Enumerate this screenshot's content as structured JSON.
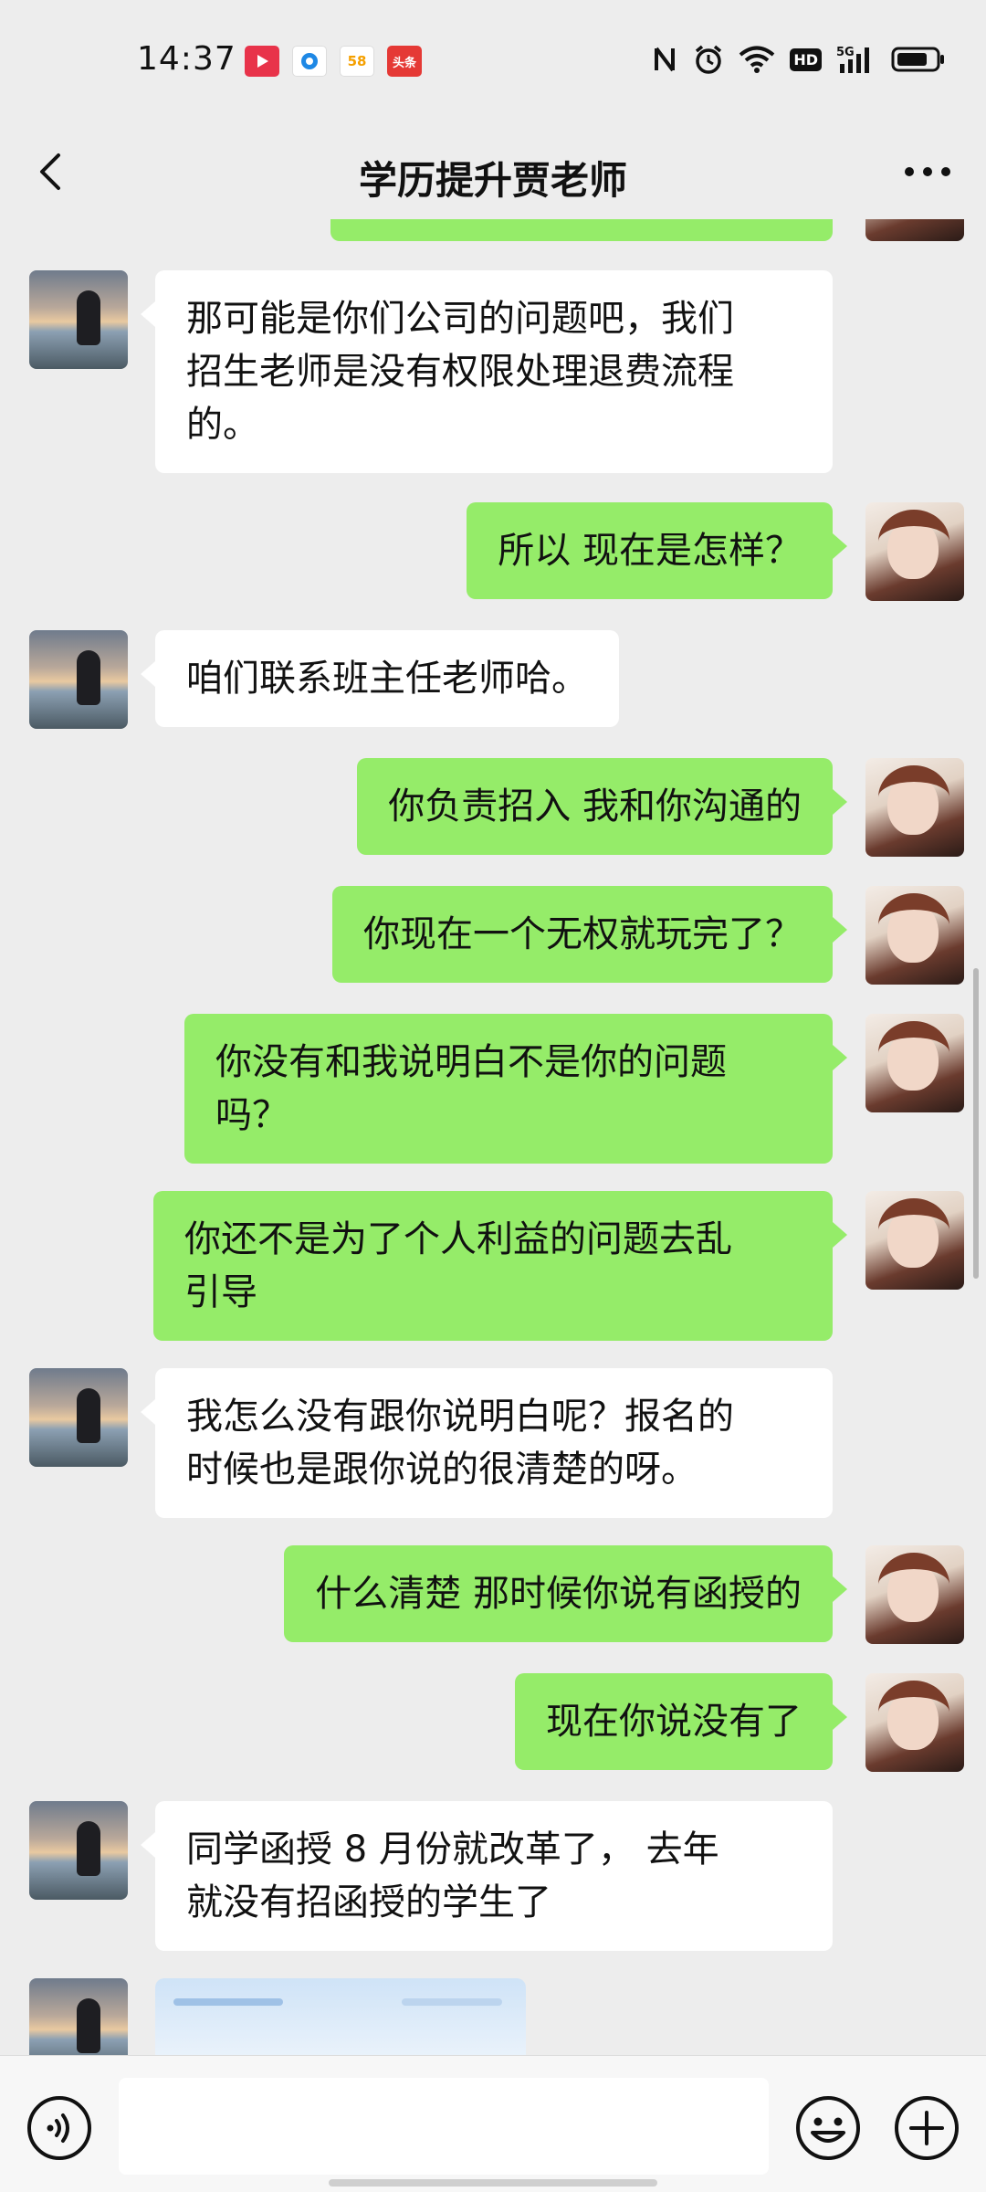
{
  "status_bar": {
    "time": "14:37",
    "notif_58": "58",
    "notif_toutiao": "头条",
    "hd": "HD",
    "network": "5G"
  },
  "header": {
    "title": "学历提升贾老师"
  },
  "messages": [
    {
      "side": "right",
      "text": ""
    },
    {
      "side": "left",
      "lines": [
        "那可能是你们公司的问题吧，我们",
        "招生老师是没有权限处理退费流程",
        "的。"
      ]
    },
    {
      "side": "right",
      "lines": [
        "所以 现在是怎样？"
      ]
    },
    {
      "side": "left",
      "lines": [
        "咱们联系班主任老师哈。"
      ]
    },
    {
      "side": "right",
      "lines": [
        "你负责招入  我和你沟通的"
      ]
    },
    {
      "side": "right",
      "lines": [
        "你现在一个无权就玩完了？"
      ]
    },
    {
      "side": "right",
      "lines": [
        "你没有和我说明白不是你的问题",
        "吗？"
      ]
    },
    {
      "side": "right",
      "lines": [
        "你还不是为了个人利益的问题去乱",
        "引导"
      ]
    },
    {
      "side": "left",
      "lines": [
        "我怎么没有跟你说明白呢？报名的",
        "时候也是跟你说的很清楚的呀。"
      ]
    },
    {
      "side": "right",
      "lines": [
        "什么清楚  那时候你说有函授的"
      ]
    },
    {
      "side": "right",
      "lines": [
        "现在你说没有了"
      ]
    },
    {
      "side": "left",
      "lines": [
        "同学函授 8 月份就改革了，  去年",
        "就没有招函授的学生了"
      ]
    },
    {
      "side": "left",
      "type": "image"
    }
  ],
  "colors": {
    "background": "#ededed",
    "bubble_self": "#95ec69",
    "bubble_other": "#ffffff"
  },
  "icons": [
    "back-arrow-icon",
    "more-dots-icon",
    "voice-icon",
    "emoji-icon",
    "plus-icon",
    "nfc-icon",
    "alarm-icon",
    "wifi-icon",
    "signal-icon",
    "battery-icon"
  ]
}
